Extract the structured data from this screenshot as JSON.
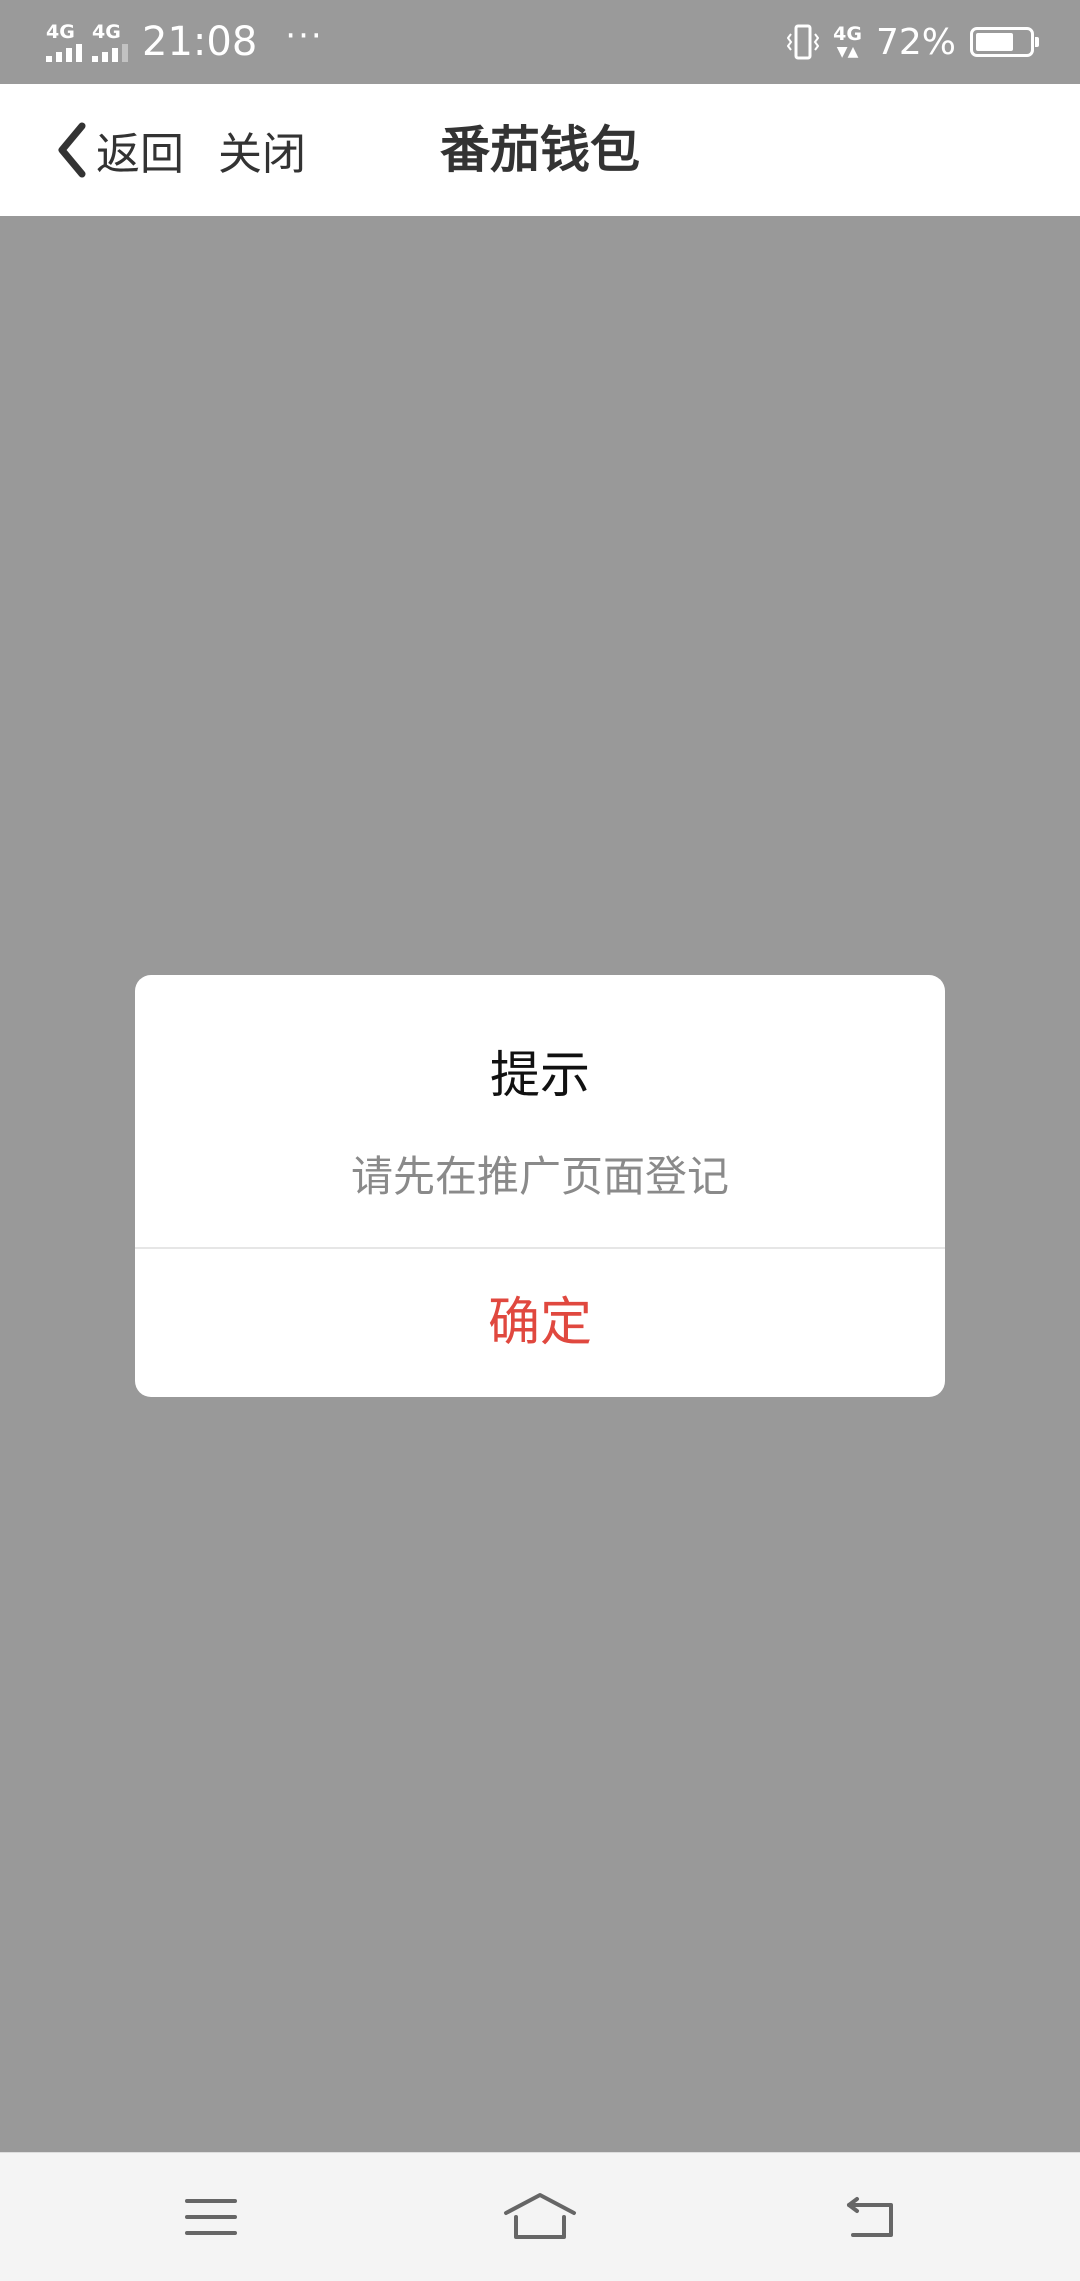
{
  "status_bar": {
    "signal_1_label": "4G",
    "signal_2_label": "4G",
    "time": "21:08",
    "more_dots": "···",
    "network_label": "4G",
    "battery_text": "72%",
    "battery_level": 0.72
  },
  "header": {
    "back_label": "返回",
    "close_label": "关闭",
    "title": "番茄钱包"
  },
  "dialog": {
    "title": "提示",
    "message": "请先在推广页面登记",
    "confirm_label": "确定",
    "confirm_color": "#e0483f"
  },
  "nav_bar": {
    "menu_icon": "menu-icon",
    "home_icon": "home-icon",
    "back_icon": "back-arrow-icon"
  },
  "colors": {
    "overlay": "#999999",
    "header_bg": "#ffffff",
    "nav_bar_bg": "#f4f4f4"
  }
}
